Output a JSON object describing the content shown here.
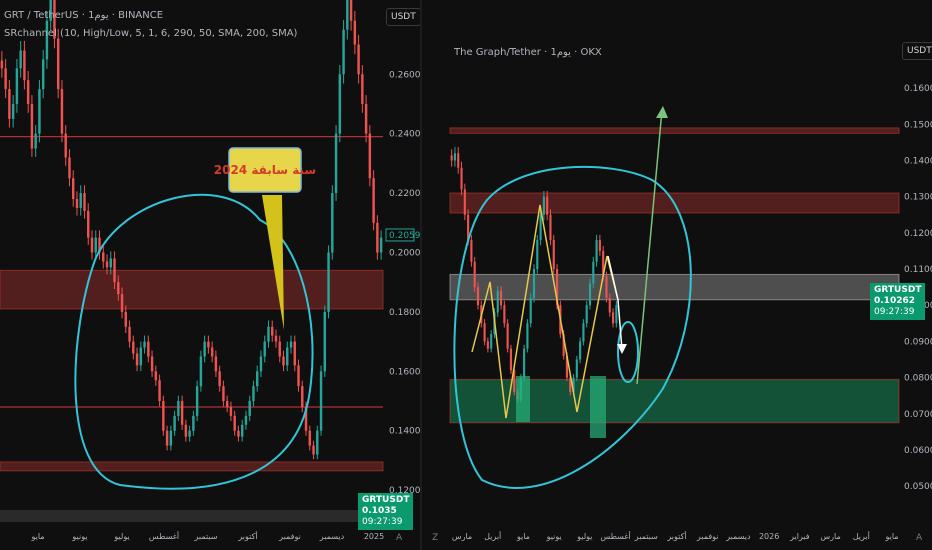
{
  "colors": {
    "up": "#26a69a",
    "down": "#ef5350",
    "red_zone": "#8b2b2b",
    "green_zone": "#1a8a5a",
    "grey_zone": "#9b9b9b",
    "cyan_drawing": "#33c4d8",
    "tag_green": "#0a9a6e"
  },
  "left_chart": {
    "symbol_line": "GRT / TetherUS · 1يوم · BINANCE",
    "indicator_line": "SRchannel (10, High/Low, 5, 1, 6, 290, 50, SMA, 200, SMA)",
    "currency": "USDT",
    "y_ticks": [
      "0.2600",
      "0.2400",
      "0.2200",
      "0.2000",
      "0.1800",
      "0.1600",
      "0.1400",
      "0.1200"
    ],
    "x_ticks": [
      "مايو",
      "يونيو",
      "يوليو",
      "أغسطس",
      "سبتمبر",
      "أكتوبر",
      "نوفمبر",
      "ديسمبر",
      "2025"
    ],
    "last_price_label": "0.2059",
    "tag_symbol": "GRTUSDT",
    "tag_price": "0.1035",
    "tag_time": "09:27:39",
    "callout_text": "سنة سابقة 2024",
    "nav_icon": "home-a-icon",
    "chart_data": {
      "type": "candlestick",
      "ylim": [
        0.115,
        0.285
      ],
      "x_range": [
        "2024-04-10",
        "2025-01-25"
      ],
      "series": [
        {
          "name": "",
          "values": [
            0.262,
            0.255,
            0.245,
            0.25,
            0.262,
            0.268,
            0.258,
            0.25,
            0.235,
            0.24,
            0.255,
            0.265,
            0.278,
            0.285,
            0.272,
            0.255,
            0.24,
            0.232,
            0.225,
            0.218,
            0.215,
            0.22,
            0.214,
            0.205,
            0.2,
            0.205,
            0.2,
            0.197,
            0.195,
            0.198,
            0.19,
            0.186,
            0.18,
            0.175,
            0.17,
            0.166,
            0.162,
            0.168,
            0.17,
            0.165,
            0.16,
            0.157,
            0.15,
            0.14,
            0.135,
            0.14,
            0.145,
            0.15,
            0.142,
            0.138,
            0.14,
            0.145,
            0.155,
            0.165,
            0.17,
            0.168,
            0.165,
            0.16,
            0.155,
            0.15,
            0.148,
            0.145,
            0.14,
            0.138,
            0.142,
            0.145,
            0.15,
            0.155,
            0.16,
            0.165,
            0.17,
            0.175,
            0.172,
            0.17,
            0.165,
            0.162,
            0.168,
            0.17,
            0.162,
            0.155,
            0.148,
            0.14,
            0.135,
            0.132,
            0.14,
            0.16,
            0.18,
            0.2,
            0.22,
            0.24,
            0.26,
            0.275,
            0.285,
            0.278,
            0.27,
            0.26,
            0.25,
            0.24,
            0.225,
            0.21,
            0.2,
            0.205
          ]
        }
      ],
      "zones": [
        {
          "kind": "resistance",
          "range": [
            0.181,
            0.194
          ]
        },
        {
          "kind": "support",
          "range": [
            0.1265,
            0.1295
          ]
        }
      ],
      "lines": [
        0.239,
        0.148
      ],
      "grid": false
    }
  },
  "right_chart": {
    "symbol_line": "The Graph/Tether · 1يوم · OKX",
    "currency": "USDT",
    "y_ticks": [
      "0.16000",
      "0.15000",
      "0.14000",
      "0.13000",
      "0.12000",
      "0.11000",
      "0.10000",
      "0.09000",
      "0.08000",
      "0.07000",
      "0.06000",
      "0.05000"
    ],
    "x_ticks": [
      "مارس",
      "أبريل",
      "مايو",
      "يونيو",
      "يوليو",
      "أغسطس",
      "سبتمبر",
      "أكتوبر",
      "نوفمبر",
      "ديسمبر",
      "2026",
      "فبراير",
      "مارس",
      "أبريل",
      "مايو"
    ],
    "tag_symbol": "GRTUSDT",
    "tag_price": "0.10262",
    "tag_time": "09:27:39",
    "nav_icon_left": "z-icon",
    "nav_icon_right": "a-icon",
    "chart_data": {
      "type": "candlestick",
      "ylim": [
        0.047,
        0.165
      ],
      "x_range": [
        "2025-02-15",
        "2026-05-31"
      ],
      "series": [
        {
          "name": "",
          "values": [
            0.14,
            0.142,
            0.138,
            0.132,
            0.125,
            0.118,
            0.112,
            0.105,
            0.1,
            0.095,
            0.09,
            0.088,
            0.092,
            0.098,
            0.104,
            0.1,
            0.095,
            0.088,
            0.082,
            0.076,
            0.074,
            0.08,
            0.088,
            0.095,
            0.102,
            0.11,
            0.118,
            0.125,
            0.13,
            0.125,
            0.118,
            0.11,
            0.1,
            0.092,
            0.086,
            0.08,
            0.076,
            0.08,
            0.085,
            0.09,
            0.095,
            0.1,
            0.106,
            0.112,
            0.118,
            0.115,
            0.108,
            0.102,
            0.098,
            0.095,
            0.1
          ]
        }
      ],
      "zones": [
        {
          "kind": "resistance",
          "range": [
            0.1475,
            0.149
          ]
        },
        {
          "kind": "resistance",
          "range": [
            0.1255,
            0.131
          ]
        },
        {
          "kind": "neutral",
          "range": [
            0.1015,
            0.1085
          ]
        },
        {
          "kind": "support",
          "range": [
            0.0675,
            0.0795
          ]
        }
      ],
      "grid": false
    }
  }
}
